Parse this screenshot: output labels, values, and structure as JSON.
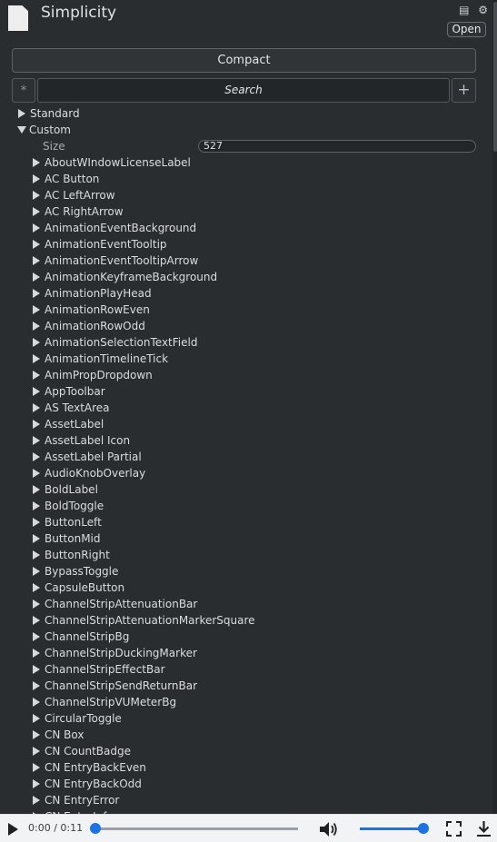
{
  "header": {
    "title": "Simplicity",
    "top_icons": "▤ ⚙",
    "open_label": "Open"
  },
  "compact_label": "Compact",
  "search": {
    "star": "*",
    "value": "Search",
    "plus": "+"
  },
  "tree": {
    "standard_label": "Standard",
    "custom_label": "Custom",
    "size_label": "Size",
    "size_value": "527",
    "items": [
      "AboutWIndowLicenseLabel",
      "AC Button",
      "AC LeftArrow",
      "AC RightArrow",
      "AnimationEventBackground",
      "AnimationEventTooltip",
      "AnimationEventTooltipArrow",
      "AnimationKeyframeBackground",
      "AnimationPlayHead",
      "AnimationRowEven",
      "AnimationRowOdd",
      "AnimationSelectionTextField",
      "AnimationTimelineTick",
      "AnimPropDropdown",
      "AppToolbar",
      "AS TextArea",
      "AssetLabel",
      "AssetLabel Icon",
      "AssetLabel Partial",
      "AudioKnobOverlay",
      "BoldLabel",
      "BoldToggle",
      "ButtonLeft",
      "ButtonMid",
      "ButtonRight",
      "BypassToggle",
      "CapsuleButton",
      "ChannelStripAttenuationBar",
      "ChannelStripAttenuationMarkerSquare",
      "ChannelStripBg",
      "ChannelStripDuckingMarker",
      "ChannelStripEffectBar",
      "ChannelStripSendReturnBar",
      "ChannelStripVUMeterBg",
      "CircularToggle",
      "CN Box",
      "CN CountBadge",
      "CN EntryBackEven",
      "CN EntryBackOdd",
      "CN EntryError",
      "CN EntryInfo"
    ]
  },
  "player": {
    "time": "0:00 / 0:11",
    "progress": 0.0,
    "volume": 1.0
  }
}
